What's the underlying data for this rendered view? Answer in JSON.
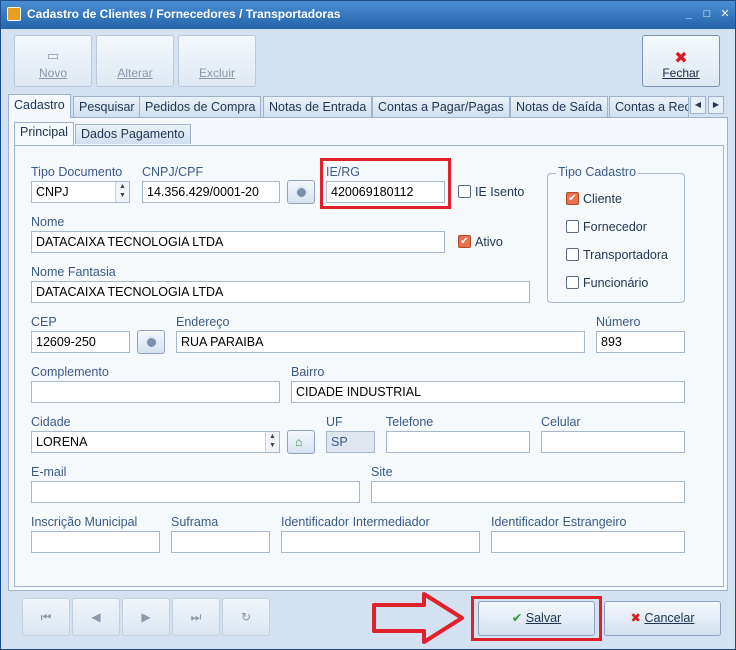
{
  "window": {
    "title": "Cadastro de Clientes / Fornecedores / Transportadoras",
    "minimize": "_",
    "maximize": "□",
    "close": "✕"
  },
  "toolbar": {
    "novo": "Novo",
    "alterar": "Alterar",
    "excluir": "Excluir",
    "fechar": "Fechar"
  },
  "tabs": [
    "Cadastro",
    "Pesquisar",
    "Pedidos de Compra",
    "Notas de Entrada",
    "Contas a Pagar/Pagas",
    "Notas de Saída",
    "Contas a Rec"
  ],
  "subtabs": [
    "Principal",
    "Dados Pagamento"
  ],
  "form": {
    "tipo_documento": {
      "label": "Tipo Documento",
      "value": "CNPJ"
    },
    "cnpj_cpf": {
      "label": "CNPJ/CPF",
      "value": "14.356.429/0001-20"
    },
    "ie_rg": {
      "label": "IE/RG",
      "value": "420069180112"
    },
    "ie_isento": {
      "label": "IE Isento",
      "checked": false
    },
    "nome": {
      "label": "Nome",
      "value": "DATACAIXA TECNOLOGIA LTDA"
    },
    "ativo": {
      "label": "Ativo",
      "checked": true
    },
    "nome_fantasia": {
      "label": "Nome Fantasia",
      "value": "DATACAIXA TECNOLOGIA LTDA"
    },
    "tipo_cadastro": {
      "label": "Tipo Cadastro",
      "options": [
        {
          "label": "Cliente",
          "checked": true
        },
        {
          "label": "Fornecedor",
          "checked": false
        },
        {
          "label": "Transportadora",
          "checked": false
        },
        {
          "label": "Funcionário",
          "checked": false
        }
      ]
    },
    "cep": {
      "label": "CEP",
      "value": "12609-250"
    },
    "endereco": {
      "label": "Endereço",
      "value": "RUA PARAIBA"
    },
    "numero": {
      "label": "Número",
      "value": "893"
    },
    "complemento": {
      "label": "Complemento",
      "value": ""
    },
    "bairro": {
      "label": "Bairro",
      "value": "CIDADE INDUSTRIAL"
    },
    "cidade": {
      "label": "Cidade",
      "value": "LORENA"
    },
    "uf": {
      "label": "UF",
      "value": "SP"
    },
    "telefone": {
      "label": "Telefone",
      "value": ""
    },
    "celular": {
      "label": "Celular",
      "value": ""
    },
    "email": {
      "label": "E-mail",
      "value": ""
    },
    "site": {
      "label": "Site",
      "value": ""
    },
    "inscricao_municipal": {
      "label": "Inscrição Municipal",
      "value": ""
    },
    "suframa": {
      "label": "Suframa",
      "value": ""
    },
    "identificador_intermediador": {
      "label": "Identificador Intermediador",
      "value": ""
    },
    "identificador_estrangeiro": {
      "label": "Identificador Estrangeiro",
      "value": ""
    }
  },
  "actions": {
    "salvar": "Salvar",
    "cancelar": "Cancelar"
  },
  "colors": {
    "highlight": "#e0202a",
    "checked": "#e8704a",
    "titlebar": "#2563a8"
  }
}
